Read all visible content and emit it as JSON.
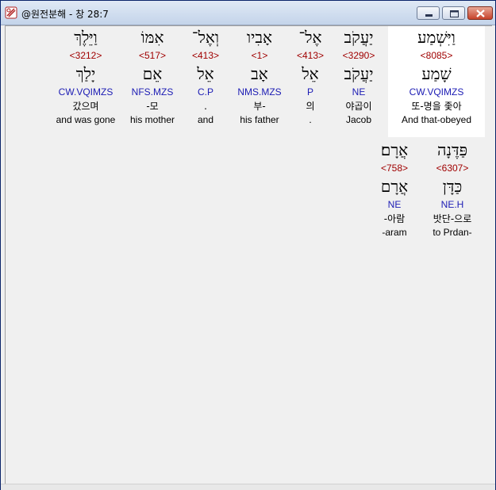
{
  "window": {
    "title": "@원전분해 - 창 28:7",
    "controls": [
      "minimize",
      "maximize",
      "close"
    ]
  },
  "words": [
    {
      "heb": "וַיִּשְׁמַע",
      "strong": "<8085>",
      "lemma": "שָׁמַע",
      "parse": "CW.VQIMZS",
      "kor": "또-명을 좇아",
      "eng": "And that-obeyed"
    },
    {
      "heb": "יַעֲקֹב",
      "strong": "<3290>",
      "lemma": "יַעֲקֹב",
      "parse": "NE",
      "kor": "야곱이",
      "eng": "Jacob"
    },
    {
      "heb": "אֶל־",
      "strong": "<413>",
      "lemma": "אֵל",
      "parse": "P",
      "kor": "의",
      "eng": "."
    },
    {
      "heb": "אָבִיו",
      "strong": "<1>",
      "lemma": "אָב",
      "parse": "NMS.MZS",
      "kor": "부-",
      "eng": "his father"
    },
    {
      "heb": "וְאֶל־",
      "strong": "<413>",
      "lemma": "אֵל",
      "parse": "C.P",
      "kor": ".",
      "eng": "and"
    },
    {
      "heb": "אִמּוֹ",
      "strong": "<517>",
      "lemma": "אֵם",
      "parse": "NFS.MZS",
      "kor": "-모",
      "eng": "his mother"
    },
    {
      "heb": "וַיֵּלֶךְ",
      "strong": "<3212>",
      "lemma": "יָלַךְ",
      "parse": "CW.VQIMZS",
      "kor": "갔으며",
      "eng": "and was gone"
    },
    {
      "heb": "פַּדֶּנָה",
      "strong": "<6307>",
      "lemma": "כַּדָּן",
      "parse": "NE.H",
      "kor": "밧단-으로",
      "eng": "to Prdan-"
    },
    {
      "heb": "אֲרָם׃",
      "strong": "<758>",
      "lemma": "אֲרָם",
      "parse": "NE",
      "kor": "-아람",
      "eng": "-aram"
    }
  ]
}
